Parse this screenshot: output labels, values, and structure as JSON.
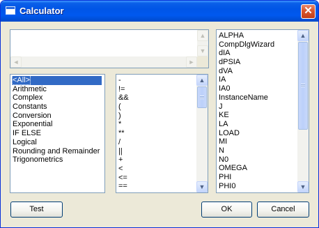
{
  "window": {
    "title": "Calculator",
    "close_label": "✕"
  },
  "categories": {
    "items": [
      "<All>",
      "Arithmetic",
      "Complex",
      "Constants",
      "Conversion",
      "Exponential",
      "IF ELSE",
      "Logical",
      "Rounding and Remainder",
      "Trigonometrics"
    ],
    "selected": "<All>"
  },
  "operators": {
    "items": [
      "-",
      "!=",
      "&&",
      "(",
      ")",
      "*",
      "**",
      "/",
      "||",
      "+",
      "<",
      "<=",
      "=="
    ]
  },
  "variables": {
    "items": [
      "ALPHA",
      "CompDlgWizard",
      "dIA",
      "dPSIA",
      "dVA",
      "IA",
      "IA0",
      "InstanceName",
      "J",
      "KE",
      "LA",
      "LOAD",
      "MI",
      "N",
      "N0",
      "OMEGA",
      "PHI",
      "PHI0"
    ]
  },
  "expression": {
    "value": ""
  },
  "buttons": {
    "test": "Test",
    "ok": "OK",
    "cancel": "Cancel"
  },
  "scroll": {
    "up": "▲",
    "down": "▼",
    "left": "◄",
    "right": "►"
  },
  "colors": {
    "titlebar": "#0055e6",
    "selection": "#316ac5",
    "face": "#ece9d8",
    "close": "#d8562d"
  }
}
